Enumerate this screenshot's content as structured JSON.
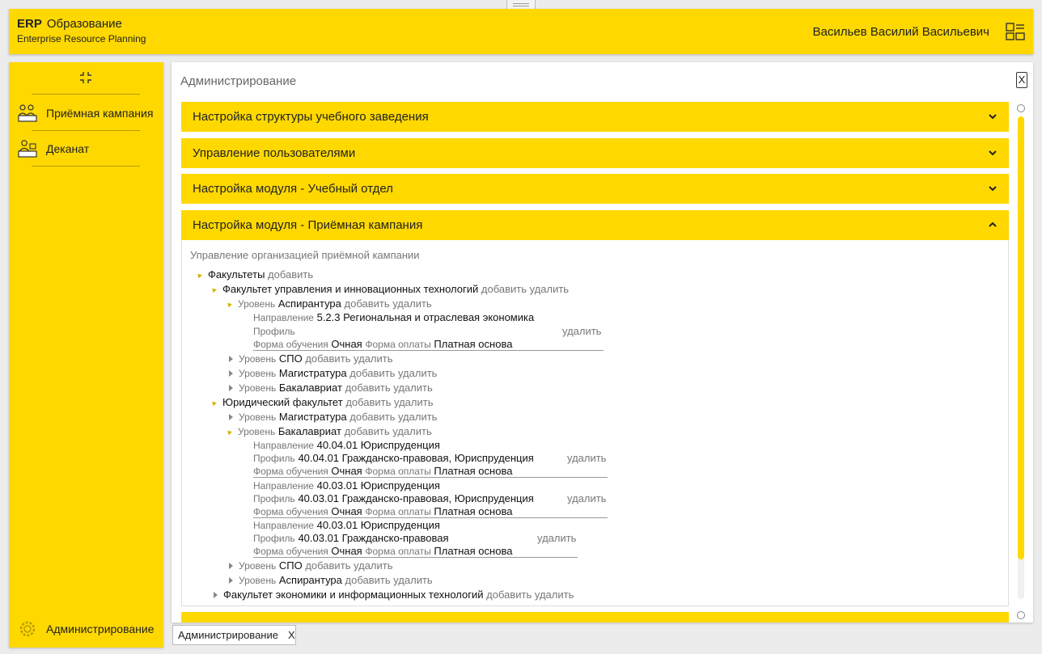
{
  "header": {
    "brand_short": "ERP",
    "brand_title": "Образование",
    "brand_subtitle": "Enterprise Resource Planning",
    "user_name": "Васильев Василий Васильевич"
  },
  "sidebar": {
    "items": [
      {
        "label": "Приёмная кампания",
        "icon": "admission-icon"
      },
      {
        "label": "Деканат",
        "icon": "deanery-icon"
      }
    ],
    "bottom_item": {
      "label": "Администрирование",
      "icon": "gear-icon"
    }
  },
  "main": {
    "title": "Администрирование",
    "close_label": "X",
    "accordions": [
      {
        "label": "Настройка структуры учебного заведения",
        "expanded": false
      },
      {
        "label": "Управление пользователями",
        "expanded": false
      },
      {
        "label": "Настройка модуля - Учебный отдел",
        "expanded": false
      },
      {
        "label": "Настройка модуля - Приёмная кампания",
        "expanded": true
      }
    ],
    "panel_subtitle": "Управление организацией приёмной кампании"
  },
  "tree": {
    "labels": {
      "add": "добавить",
      "delete": "удалить",
      "level": "Уровень",
      "direction": "Направление",
      "profile": "Профиль",
      "study_form": "Форма обучения",
      "payment_form": "Форма оплаты"
    },
    "root": "Факультеты",
    "f1": {
      "name": "Факультет управления и инновационных технологий",
      "l1": "Аспирантура",
      "l1_direction": "5.2.3  Региональная и отраслевая экономика",
      "l1_profile": "",
      "l1_study": "Очная",
      "l1_pay": "Платная основа",
      "l2": "СПО",
      "l3": "Магистратура",
      "l4": "Бакалавриат"
    },
    "f2": {
      "name": "Юридический факультет",
      "l1": "Магистратура",
      "l2": "Бакалавриат",
      "programs": [
        {
          "direction": "40.04.01  Юриспруденция",
          "profile": "40.04.01  Гражданско-правовая, Юриспруденция",
          "study": "Очная",
          "pay": "Платная основа"
        },
        {
          "direction": "40.03.01  Юриспруденция",
          "profile": "40.03.01  Гражданско-правовая, Юриспруденция",
          "study": "Очная",
          "pay": "Платная основа"
        },
        {
          "direction": "40.03.01  Юриспруденция",
          "profile": "40.03.01  Гражданско-правовая",
          "study": "Очная",
          "pay": "Платная основа"
        }
      ],
      "l3": "СПО",
      "l4": "Аспирантура"
    },
    "f3": {
      "name": "Факультет экономики и информационных технологий"
    }
  },
  "bottom_tab": {
    "label": "Администрирование",
    "close": "X"
  },
  "colors": {
    "accent": "#ffd800",
    "background": "#ececec"
  }
}
